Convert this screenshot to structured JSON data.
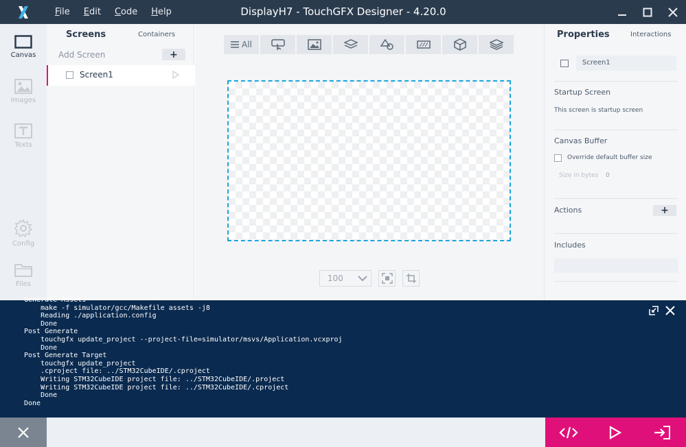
{
  "titlebar": {
    "title": "DisplayH7 - TouchGFX Designer - 4.20.0",
    "menu": [
      {
        "first": "F",
        "rest": "ile"
      },
      {
        "first": "E",
        "rest": "dit"
      },
      {
        "first": "C",
        "rest": "ode"
      },
      {
        "first": "H",
        "rest": "elp"
      }
    ],
    "logo_icon": "touchgfx-x-logo",
    "window_controls": [
      "minimize-icon",
      "maximize-icon",
      "close-icon"
    ]
  },
  "leftnav": {
    "items": [
      {
        "label": "Canvas",
        "icon": "canvas-icon",
        "active": true
      },
      {
        "label": "Images",
        "icon": "image-icon",
        "active": false
      },
      {
        "label": "Texts",
        "icon": "text-icon",
        "active": false
      },
      {
        "label": "Config",
        "icon": "gear-icon",
        "active": false
      },
      {
        "label": "Files",
        "icon": "folder-icon",
        "active": false
      }
    ]
  },
  "screens_panel": {
    "tab_screens": "Screens",
    "tab_containers": "Containers",
    "add_screen": "Add Screen",
    "add_symbol": "+",
    "screens": [
      {
        "name": "Screen1",
        "selected": true
      }
    ]
  },
  "canvas": {
    "toolbar": [
      {
        "label": "All",
        "icon": "list-icon"
      },
      {
        "label": "",
        "icon": "widget-button-icon"
      },
      {
        "label": "",
        "icon": "image-widget-icon"
      },
      {
        "label": "",
        "icon": "container-icon"
      },
      {
        "label": "",
        "icon": "shapes-icon"
      },
      {
        "label": "",
        "icon": "progress-icon"
      },
      {
        "label": "",
        "icon": "3d-box-icon"
      },
      {
        "label": "",
        "icon": "layers-icon"
      }
    ],
    "zoom": "100",
    "accent_color": "#1aa5dc"
  },
  "properties": {
    "title": "Properties",
    "interactions_tab": "Interactions",
    "screen_name": "Screen1",
    "startup_heading": "Startup Screen",
    "startup_text": "This screen is startup screen",
    "canvas_buffer_heading": "Canvas Buffer",
    "override_label": "Override default buffer size",
    "size_label": "Size in bytes",
    "size_value": "0",
    "actions_heading": "Actions",
    "actions_plus": "+",
    "includes_heading": "Includes"
  },
  "console": {
    "lines": [
      "Generate Assets",
      "    make -f simulator/gcc/Makefile assets -j8",
      "    Reading ./application.config",
      "    Done",
      "Post Generate",
      "    touchgfx update_project --project-file=simulator/msvs/Application.vcxproj",
      "    Done",
      "Post Generate Target",
      "    touchgfx update_project",
      "    .cproject file: ../STM32CubeIDE/.cproject",
      "    Writing STM32CubeIDE project file: ../STM32CubeIDE/.project",
      "    Writing STM32CubeIDE project file: ../STM32CubeIDE/.cproject",
      "    Done",
      "Done"
    ]
  },
  "colors": {
    "titlebar": "#2b3b4e",
    "console_bg": "#0a2a4f",
    "accent_pink": "#e0107a"
  }
}
